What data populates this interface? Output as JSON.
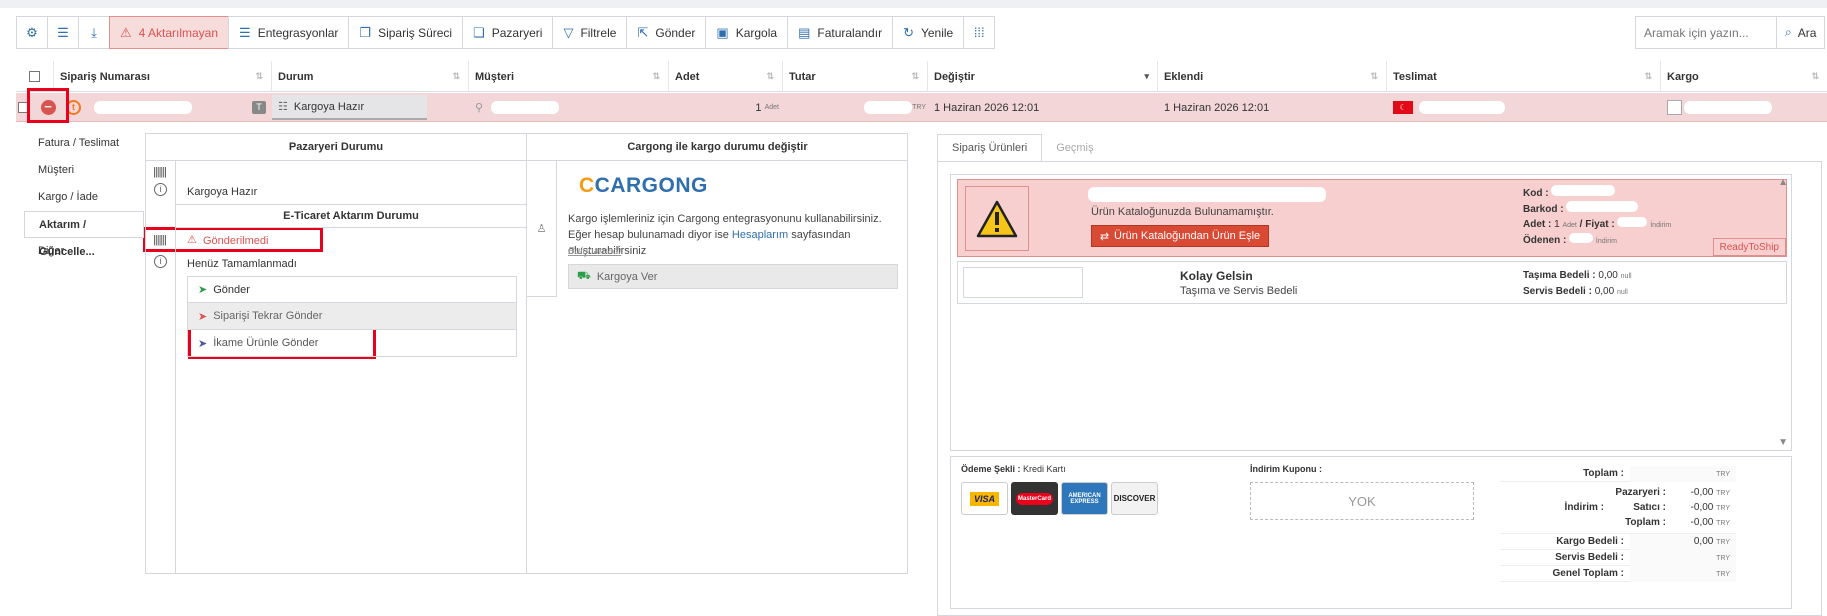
{
  "toolbar": {
    "warn_label": "4 Aktarılmayan",
    "integrations": "Entegrasyonlar",
    "process": "Sipariş Süreci",
    "marketplace": "Pazaryeri",
    "filter": "Filtrele",
    "send": "Gönder",
    "cargo": "Kargola",
    "invoice": "Faturalandır",
    "refresh": "Yenile"
  },
  "search": {
    "placeholder": "Aramak için yazın...",
    "button": "Ara"
  },
  "table": {
    "headers": [
      "Sipariş Numarası",
      "Durum",
      "Müşteri",
      "Adet",
      "Tutar",
      "Değiştir",
      "Eklendi",
      "Teslimat",
      "Kargo"
    ],
    "row": {
      "status": "Kargoya Hazır",
      "badge": "T",
      "qty": "1",
      "qty_unit": "Adet",
      "currency": "TRY",
      "changed": "1 Haziran 2026 12:01",
      "added": "1 Haziran 2026 12:01"
    }
  },
  "leftnav": [
    "Fatura / Teslimat",
    "Müşteri",
    "Kargo / İade",
    "Aktarım / Güncelle...",
    "Diğer"
  ],
  "marketplace_panel": {
    "title": "Pazaryeri Durumu",
    "status": "Kargoya Hazır",
    "ecom_title": "E-Ticaret Aktarım Durumu",
    "not_sent": "Gönderilmedi",
    "incomplete": "Henüz Tamamlanmadı",
    "actions": [
      "Gönder",
      "Siparişi Tekrar Gönder",
      "İkame Ürünle Gönder"
    ]
  },
  "cargo_panel": {
    "title": "Cargong ile kargo durumu değiştir",
    "logo_a": "C",
    "logo_b": "CARGONG",
    "text1": "Kargo işlemleriniz için Cargong entegrasyonunu kullanabilirsiniz. Eğer hesap bulunamadı diyor ise",
    "link": "Hesaplarım",
    "text2": "sayfasından oluşturabilirsiniz",
    "not_found": "Bulunamadı",
    "button": "Kargoya Ver"
  },
  "right": {
    "tabs": [
      "Sipariş Ürünleri",
      "Geçmiş"
    ],
    "product": {
      "message": "Ürün Kataloğunuzda Bulunamamıştır.",
      "match_button": "Ürün Kataloğundan Ürün Eşle",
      "kod": "Kod :",
      "barkod": "Barkod :",
      "adet": "Adet :",
      "adet_val": "1",
      "adet_unit": "Adet",
      "fiyat": "/ Fiyat :",
      "indirim": "İndirim",
      "odenen": "Ödenen :",
      "badge": "ReadyToShip"
    },
    "shipping": {
      "title": "Kolay Gelsin",
      "subtitle": "Taşıma ve Servis Bedeli",
      "tasima": "Taşıma Bedeli :",
      "tasima_val": "0,00",
      "servis": "Servis Bedeli :",
      "servis_val": "0,00",
      "null_unit": "null"
    },
    "payment": {
      "label": "Ödeme Şekli :",
      "method": "Kredi Kartı",
      "cards": [
        "VISA",
        "MasterCard",
        "AMERICAN EXPRESS",
        "DISCOVER"
      ],
      "coupon_label": "İndirim Kuponu :",
      "coupon": "YOK"
    },
    "totals": {
      "toplam": "Toplam :",
      "indirim": "İndirim :",
      "pazaryeri": "Pazaryeri :",
      "satici": "Satıcı :",
      "toplam2": "Toplam :",
      "kargo": "Kargo Bedeli :",
      "servis": "Servis Bedeli :",
      "genel": "Genel Toplam :",
      "neg": "-0,00",
      "zero": "0,00",
      "try": "TRY"
    }
  },
  "colors": {
    "accent": "#2f6fad",
    "danger": "#d9534f",
    "row_bg": "#f2d6d8",
    "highlight": "#e8001c"
  }
}
